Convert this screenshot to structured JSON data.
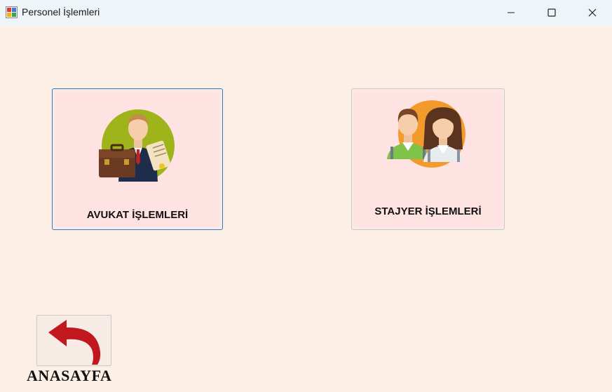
{
  "window": {
    "title": "Personel İşlemleri",
    "icon": "form-app-icon",
    "controls": [
      "minimize-icon",
      "maximize-icon",
      "close-icon"
    ]
  },
  "tiles": {
    "avukat": {
      "label": "AVUKAT İŞLEMLERİ",
      "icon": "lawyer-briefcase-icon"
    },
    "stajyer": {
      "label": "STAJYER İŞLEMLERİ",
      "icon": "interns-icon"
    }
  },
  "home": {
    "label": "ANASAYFA",
    "icon": "back-arrow-icon"
  },
  "colors": {
    "background": "#fbefe6",
    "tile_background": "#ffe2e2",
    "focus_border": "#2f7bbf",
    "arrow": "#c0181c"
  }
}
